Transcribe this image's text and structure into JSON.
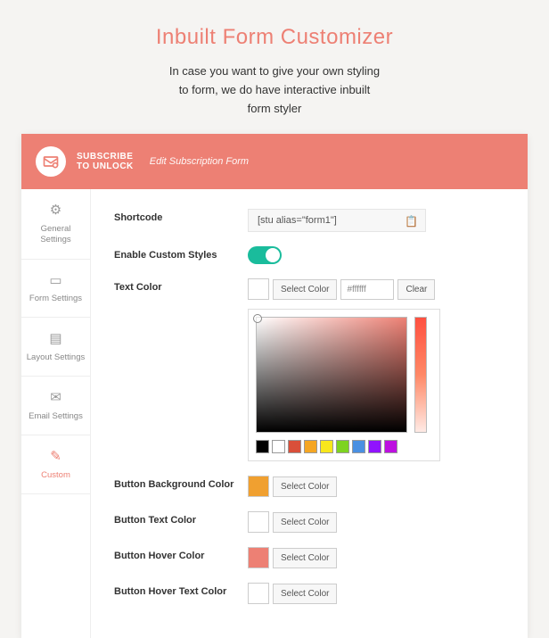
{
  "page": {
    "title": "Inbuilt Form Customizer",
    "description_l1": "In case you want to give your own styling",
    "description_l2": "to form, we do have interactive inbuilt",
    "description_l3": "form styler"
  },
  "header": {
    "logo_l1": "SUBSCRIBE",
    "logo_l2": "TO UNLOCK",
    "subtitle": "Edit Subscription Form"
  },
  "sidebar": {
    "items": [
      {
        "label": "General Settings"
      },
      {
        "label": "Form Settings"
      },
      {
        "label": "Layout Settings"
      },
      {
        "label": "Email Settings"
      },
      {
        "label": "Custom"
      }
    ]
  },
  "fields": {
    "shortcode": {
      "label": "Shortcode",
      "value": "[stu alias=\"form1\"]"
    },
    "enable_custom": {
      "label": "Enable Custom Styles"
    },
    "text_color": {
      "label": "Text Color",
      "select_btn": "Select Color",
      "hex": "#ffffff",
      "clear_btn": "Clear"
    },
    "btn_bg": {
      "label": "Button Background Color",
      "select_btn": "Select Color"
    },
    "btn_text": {
      "label": "Button Text Color",
      "select_btn": "Select Color"
    },
    "btn_hover": {
      "label": "Button Hover Color",
      "select_btn": "Select Color"
    },
    "btn_hover_text": {
      "label": "Button Hover Text Color",
      "select_btn": "Select Color"
    }
  },
  "palette": [
    "#000000",
    "#ffffff",
    "#d94f3a",
    "#f5a623",
    "#f8e71c",
    "#7ed321",
    "#4a90e2",
    "#9013fe",
    "#bd10e0"
  ]
}
